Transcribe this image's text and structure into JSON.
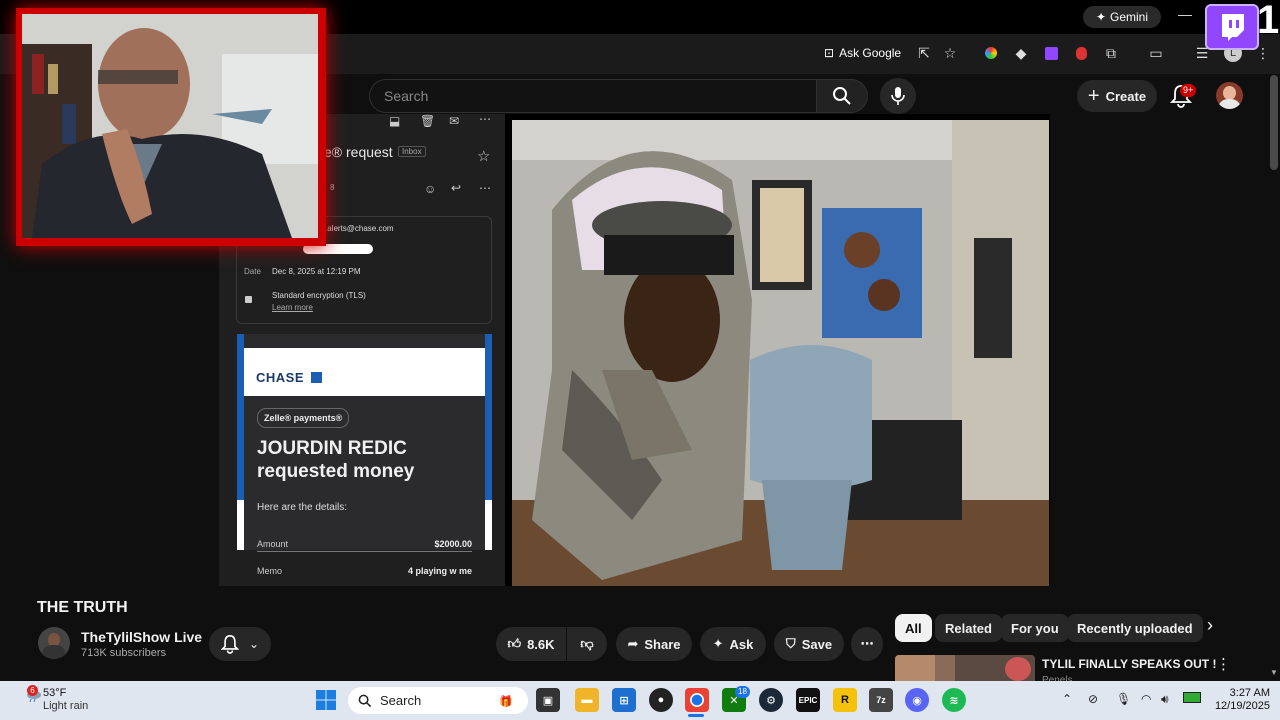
{
  "browser": {
    "gemini_label": "Gemini",
    "ask_google_label": "Ask Google",
    "profile_initial": "L",
    "overlay_number": "1"
  },
  "youtube": {
    "search_placeholder": "Search",
    "create_label": "Create",
    "notification_count": "9+"
  },
  "stream_email": {
    "subject": "e® request",
    "inbox_tag": "Inbox",
    "count_fragment": "8",
    "from_fragment": ".alerts@chase.com",
    "date_label": "Date",
    "date_value": "Dec 8, 2025 at 12:19 PM",
    "encryption": "Standard encryption (TLS)",
    "learn_more": "Learn more",
    "bank_logo": "CHASE",
    "zelle_tag": "Zelle® payments®",
    "requester": "JOURDIN REDIC",
    "requested_text": "requested money",
    "details_text": "Here are the details:",
    "amount_label": "Amount",
    "amount_value": "$2000.00",
    "memo_label": "Memo",
    "memo_value": "4 playing w me"
  },
  "video": {
    "title": "THE TRUTH",
    "channel_name": "TheTylilShow Live",
    "subscribers": "713K subscribers",
    "like_count": "8.6K",
    "share_label": "Share",
    "ask_label": "Ask",
    "save_label": "Save"
  },
  "sidebar": {
    "chips": [
      "All",
      "Related",
      "For you",
      "Recently uploaded"
    ],
    "rec_title": "TYLIL FINALLY SPEAKS OUT !",
    "rec_sub": "Penels"
  },
  "taskbar": {
    "weather_badge": "6",
    "temperature": "53°F",
    "weather_desc": "Light rain",
    "search_label": "Search",
    "xbox_badge": "18",
    "time": "3:27 AM",
    "date": "12/19/2025"
  },
  "colors": {
    "facecam_border": "#cc0000",
    "twitch": "#9146ff",
    "chase_blue": "#1a5fb4"
  }
}
